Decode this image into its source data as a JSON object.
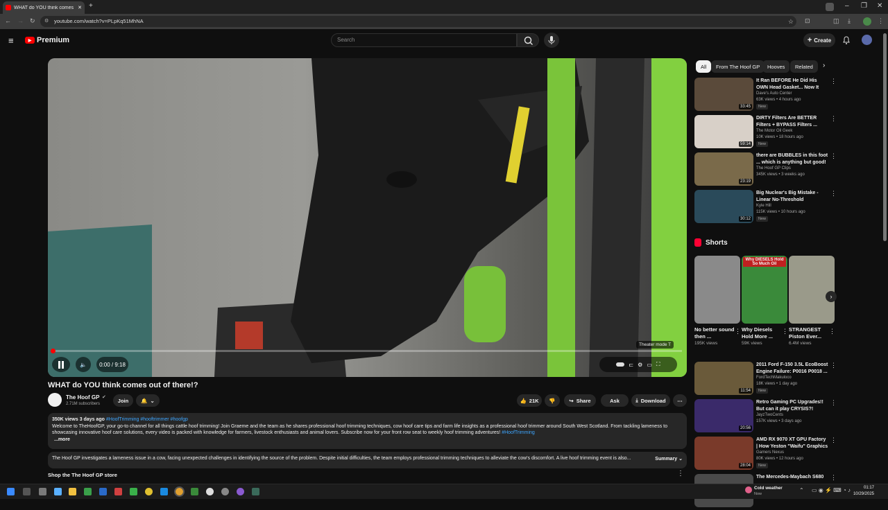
{
  "browser": {
    "tab_title": "WHAT do YOU think comes out of there!?",
    "url": "youtube.com/watch?v=PLpKq51MhNA",
    "new_tab_label": "+",
    "window_controls": [
      "–",
      "❐",
      "✕"
    ]
  },
  "header": {
    "logo_text": "Premium",
    "search_placeholder": "Search",
    "create_label": "Create",
    "icons": [
      "menu-icon",
      "search-icon",
      "mic-icon",
      "bell-icon",
      "avatar"
    ]
  },
  "player": {
    "time": "0:00 / 9:18",
    "progress": 0,
    "tooltip": "Theater mode",
    "tooltip_key": "T"
  },
  "video": {
    "title": "WHAT do YOU think comes out of there!?",
    "channel": "The Hoof GP",
    "subscribers": "2.71M subscribers",
    "join": "Join",
    "likes": "21K",
    "share": "Share",
    "ask": "Ask",
    "download": "Download"
  },
  "description": {
    "stats": "350K views  3 days ago",
    "tags": "#HoofTrimming #hooftrimmer #hoofgp",
    "text": "Welcome to TheHoofGP, your go-to channel for all things cattle hoof trimming! Join Graeme and the team as he shares professional hoof trimming techniques, cow hoof care tips and farm life insights as a professional hoof trimmer around South West Scotland. From tackling lameness to showcasing innovative hoof care solutions, every video is packed with knowledge for farmers, livestock enthusiasts and animal lovers. Subscribe now for your front row seat to weekly hoof trimming adventures!",
    "text_tag": "#HoofTrimming",
    "more": "...more"
  },
  "summary": {
    "text": "The Hoof GP investigates a lameness issue in a cow, facing unexpected challenges in identifying the source of the problem. Despite initial difficulties, the team employs professional trimming techniques to alleviate the cow's discomfort. A live hoof trimming event is also...",
    "label": "Summary"
  },
  "shop": "Shop the The Hoof GP store",
  "chips": [
    "All",
    "From The Hoof GP",
    "Hooves",
    "Related"
  ],
  "recs": [
    {
      "title": "It Ran BEFORE He Did His OWN Head Gasket... Now It Won't ...",
      "channel": "Dave's Auto Center",
      "views": "63K views • 4 hours ago",
      "badge": "New",
      "dur": "33:45",
      "color": "#5a4a3a"
    },
    {
      "title": "DIRTY Filters Are BETTER Filters + BYPASS Filters ...",
      "channel": "The Motor Oil Geek",
      "views": "10K views • 18 hours ago",
      "badge": "New",
      "dur": "59:14",
      "color": "#d8d0c8"
    },
    {
      "title": "there are BUBBLES in this foot ... which is anything but good!",
      "channel": "The Hoof GP Clips",
      "views": "345K views • 3 weeks ago",
      "badge": "",
      "dur": "23:19",
      "color": "#7a6a4a"
    },
    {
      "title": "Big Nuclear's Big Mistake - Linear No-Threshold",
      "channel": "Kyle Hill",
      "views": "115K views • 10 hours ago",
      "badge": "New",
      "dur": "30:12",
      "color": "#2a4a5a"
    }
  ],
  "shorts_title": "Shorts",
  "shorts": [
    {
      "title": "No better sound then ...",
      "views": "195K views",
      "color": "#8a8a8a"
    },
    {
      "title": "Why Diesels Hold More ...",
      "views": "59K views",
      "color": "#3a8a3a",
      "overlay": "Why DIESELS Hold So Much Oil"
    },
    {
      "title": "STRANGEST Piston Ever...",
      "views": "6.4M views",
      "color": "#9a9a8a"
    }
  ],
  "recs2": [
    {
      "title": "2011 Ford F-150 3.5L EcoBoost Engine Failure: P0016 P0018 ...",
      "channel": "FordTechMakuloco",
      "views": "18K views • 1 day ago",
      "badge": "New",
      "dur": "11:54",
      "color": "#6a5a3a"
    },
    {
      "title": "Retro Gaming PC Upgrades!! But can it play CRYSIS?!",
      "channel": "JayzTwoCents",
      "views": "157K views • 3 days ago",
      "badge": "",
      "dur": "20:56",
      "color": "#3a2a6a"
    },
    {
      "title": "AMD RX 9070 XT GPU Factory | How Yeston \"Waifu\" Graphics ...",
      "channel": "Gamers Nexus",
      "views": "80K views • 12 hours ago",
      "badge": "New",
      "dur": "28:04",
      "color": "#7a3a2a"
    },
    {
      "title": "The Mercedes-Maybach S680",
      "channel": "",
      "views": "",
      "badge": "",
      "dur": "",
      "color": "#4a4a4a"
    }
  ],
  "taskbar": {
    "weather": "Cold weather",
    "weather_sub": "Now",
    "time": "01:17",
    "date": "10/29/2025"
  }
}
